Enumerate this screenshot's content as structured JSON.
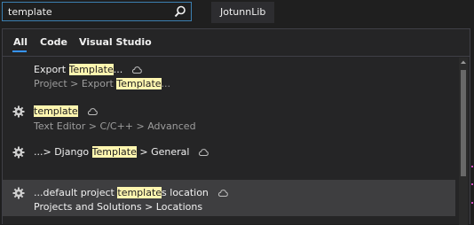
{
  "search": {
    "value": "template"
  },
  "project_tab": {
    "label": "JotunnLib"
  },
  "filter_tabs": [
    {
      "label": "All"
    },
    {
      "label": "Code"
    },
    {
      "label": "Visual Studio"
    }
  ],
  "results": [
    {
      "title_pre": "Export ",
      "title_hl": "Template",
      "title_post": "...",
      "sub_pre": "Project > Export ",
      "sub_hl": "Template",
      "sub_post": "...",
      "icon": "none"
    },
    {
      "title_pre": "",
      "title_hl": "template",
      "title_post": "",
      "sub_pre": "Text Editor > C/C++ > Advanced",
      "sub_hl": "",
      "sub_post": "",
      "icon": "gear-icon"
    },
    {
      "title_pre": "...> Django ",
      "title_hl": "Template",
      "title_post": " > General",
      "icon": "gear-icon"
    },
    {
      "title_pre": "...default project ",
      "title_hl": "template",
      "title_post": "s location",
      "sub_pre": "Projects and Solutions > Locations",
      "icon": "gear-icon"
    }
  ],
  "colors": {
    "highlight": "#fff6b0",
    "accent": "#3794ff",
    "search_border": "#3c7fb1"
  }
}
